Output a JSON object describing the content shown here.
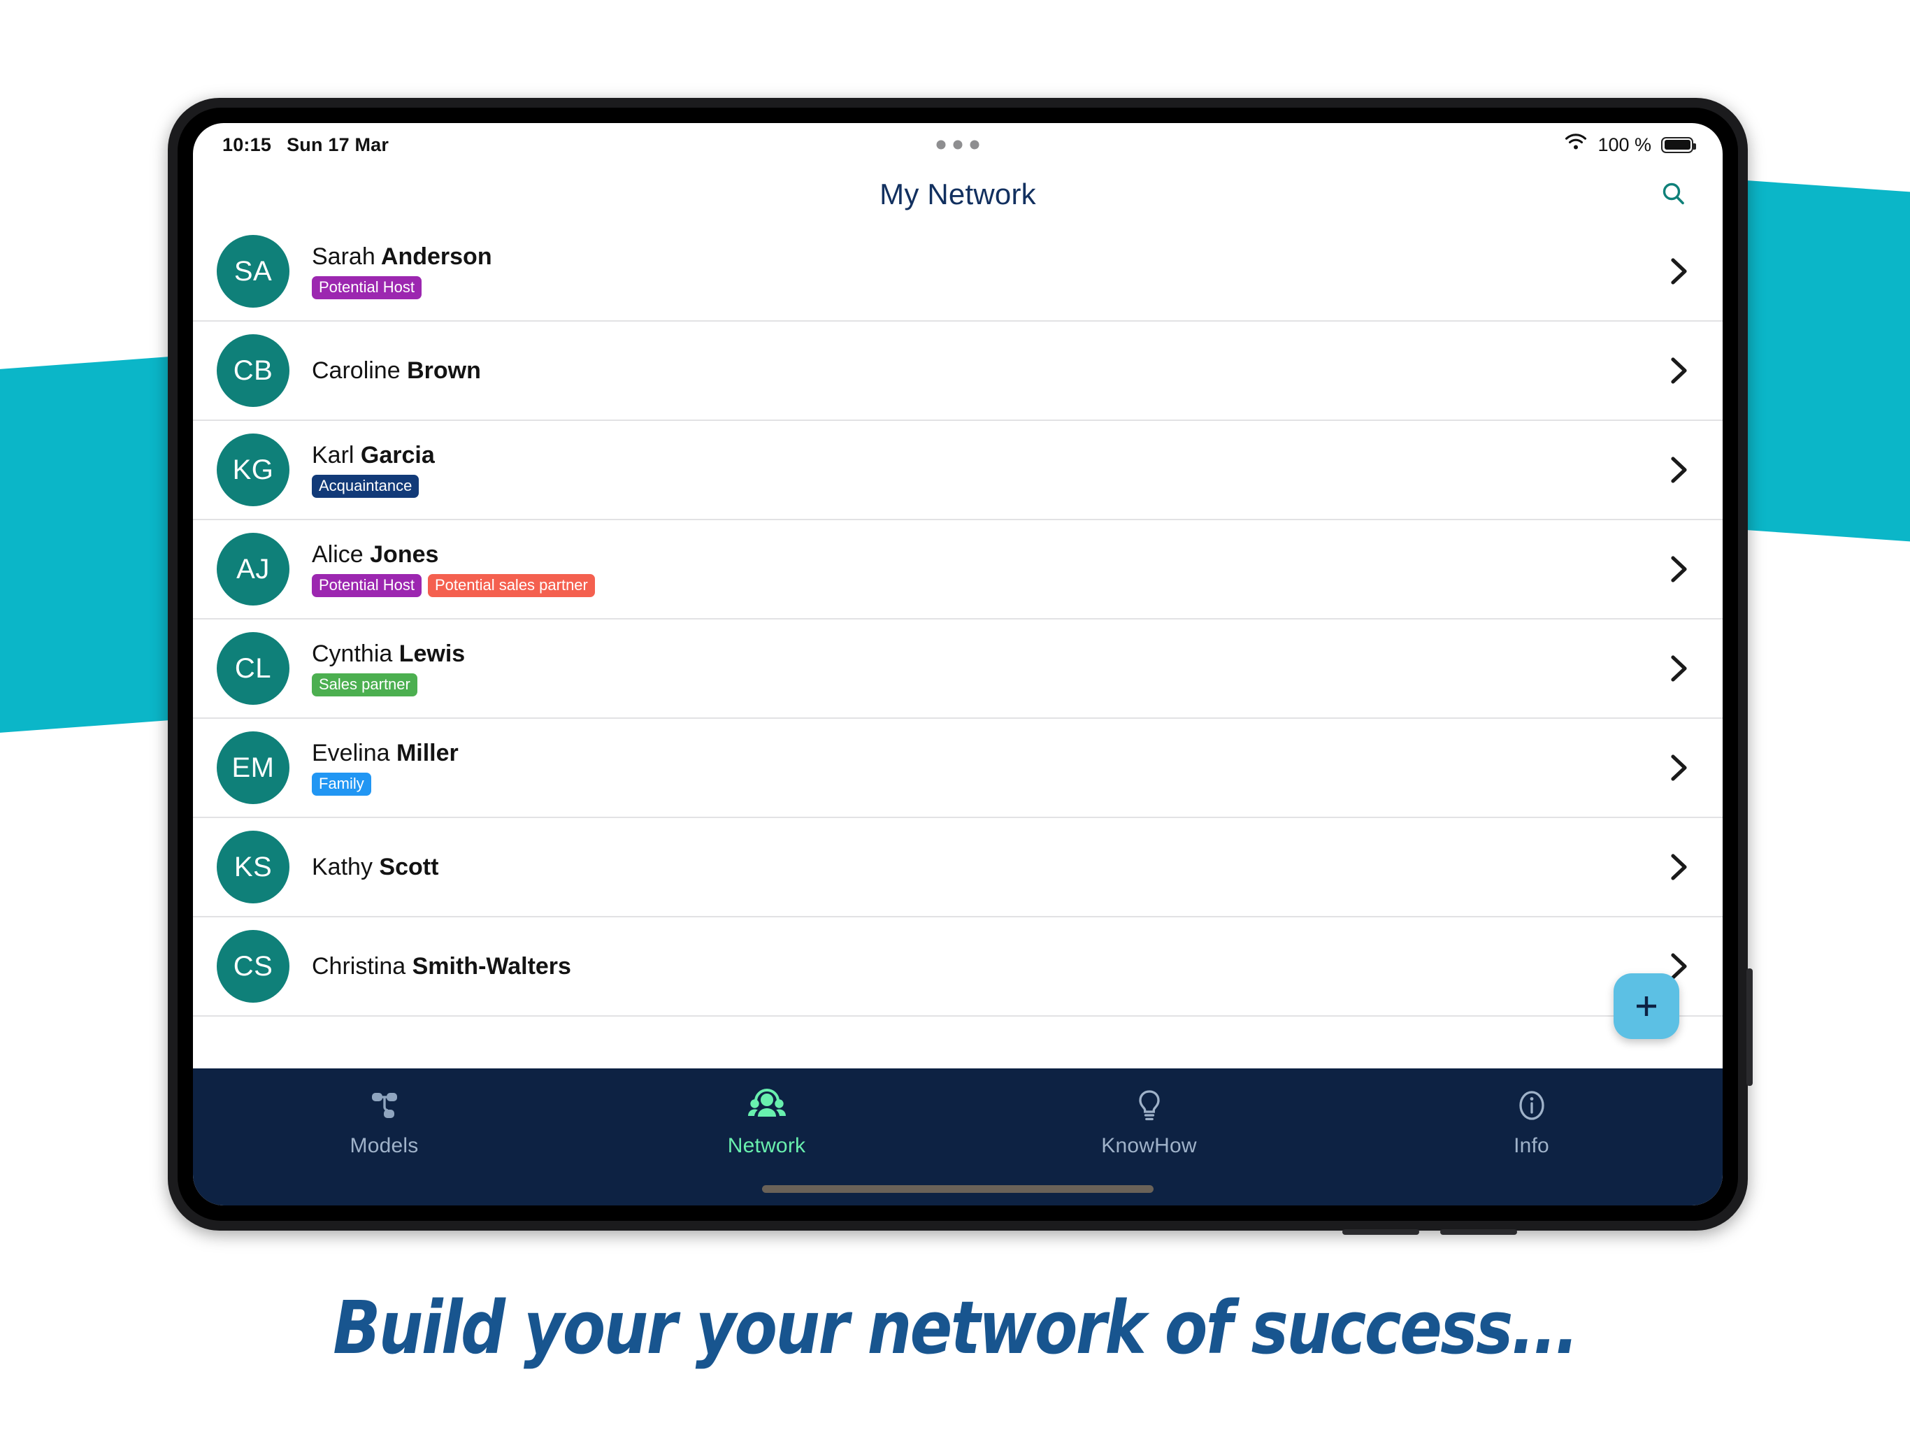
{
  "statusbar": {
    "time": "10:15",
    "date": "Sun 17 Mar",
    "battery_pct": "100 %",
    "wifi_icon": "wifi-icon",
    "battery_icon": "battery-full-icon",
    "multitask_icon": "multitask-dots-icon"
  },
  "header": {
    "title": "My Network",
    "search_icon": "search-icon",
    "title_color": "#12305f",
    "search_color": "#0f8079"
  },
  "tag_colors": {
    "Potential Host": "#9c27b0",
    "Acquaintance": "#123a78",
    "Potential sales partner": "#f4604f",
    "Sales partner": "#4caf50",
    "Family": "#2196f3"
  },
  "contacts": [
    {
      "initials": "SA",
      "first": "Sarah",
      "last": "Anderson",
      "tags": [
        "Potential Host"
      ]
    },
    {
      "initials": "CB",
      "first": "Caroline",
      "last": "Brown",
      "tags": []
    },
    {
      "initials": "KG",
      "first": "Karl",
      "last": "Garcia",
      "tags": [
        "Acquaintance"
      ]
    },
    {
      "initials": "AJ",
      "first": "Alice",
      "last": "Jones",
      "tags": [
        "Potential Host",
        "Potential sales partner"
      ]
    },
    {
      "initials": "CL",
      "first": "Cynthia",
      "last": "Lewis",
      "tags": [
        "Sales partner"
      ]
    },
    {
      "initials": "EM",
      "first": "Evelina",
      "last": "Miller",
      "tags": [
        "Family"
      ]
    },
    {
      "initials": "KS",
      "first": "Kathy",
      "last": "Scott",
      "tags": []
    },
    {
      "initials": "CS",
      "first": "Christina",
      "last": "Smith-Walters",
      "tags": []
    }
  ],
  "fab": {
    "label": "+",
    "icon": "plus-icon",
    "color": "#5cc0e4"
  },
  "tabbar": {
    "background": "#0d2243",
    "active_color": "#69f0ae",
    "inactive_color": "#9fb2c9",
    "tabs": [
      {
        "label": "Models",
        "icon": "hierarchy-icon",
        "active": false
      },
      {
        "label": "Network",
        "icon": "people-group-icon",
        "active": true
      },
      {
        "label": "KnowHow",
        "icon": "lightbulb-icon",
        "active": false
      },
      {
        "label": "Info",
        "icon": "info-circle-icon",
        "active": false
      }
    ]
  },
  "tagline": {
    "text": "Build your your network of success...",
    "color": "#18558f"
  },
  "decor": {
    "band_color": "#0bb6c8"
  }
}
